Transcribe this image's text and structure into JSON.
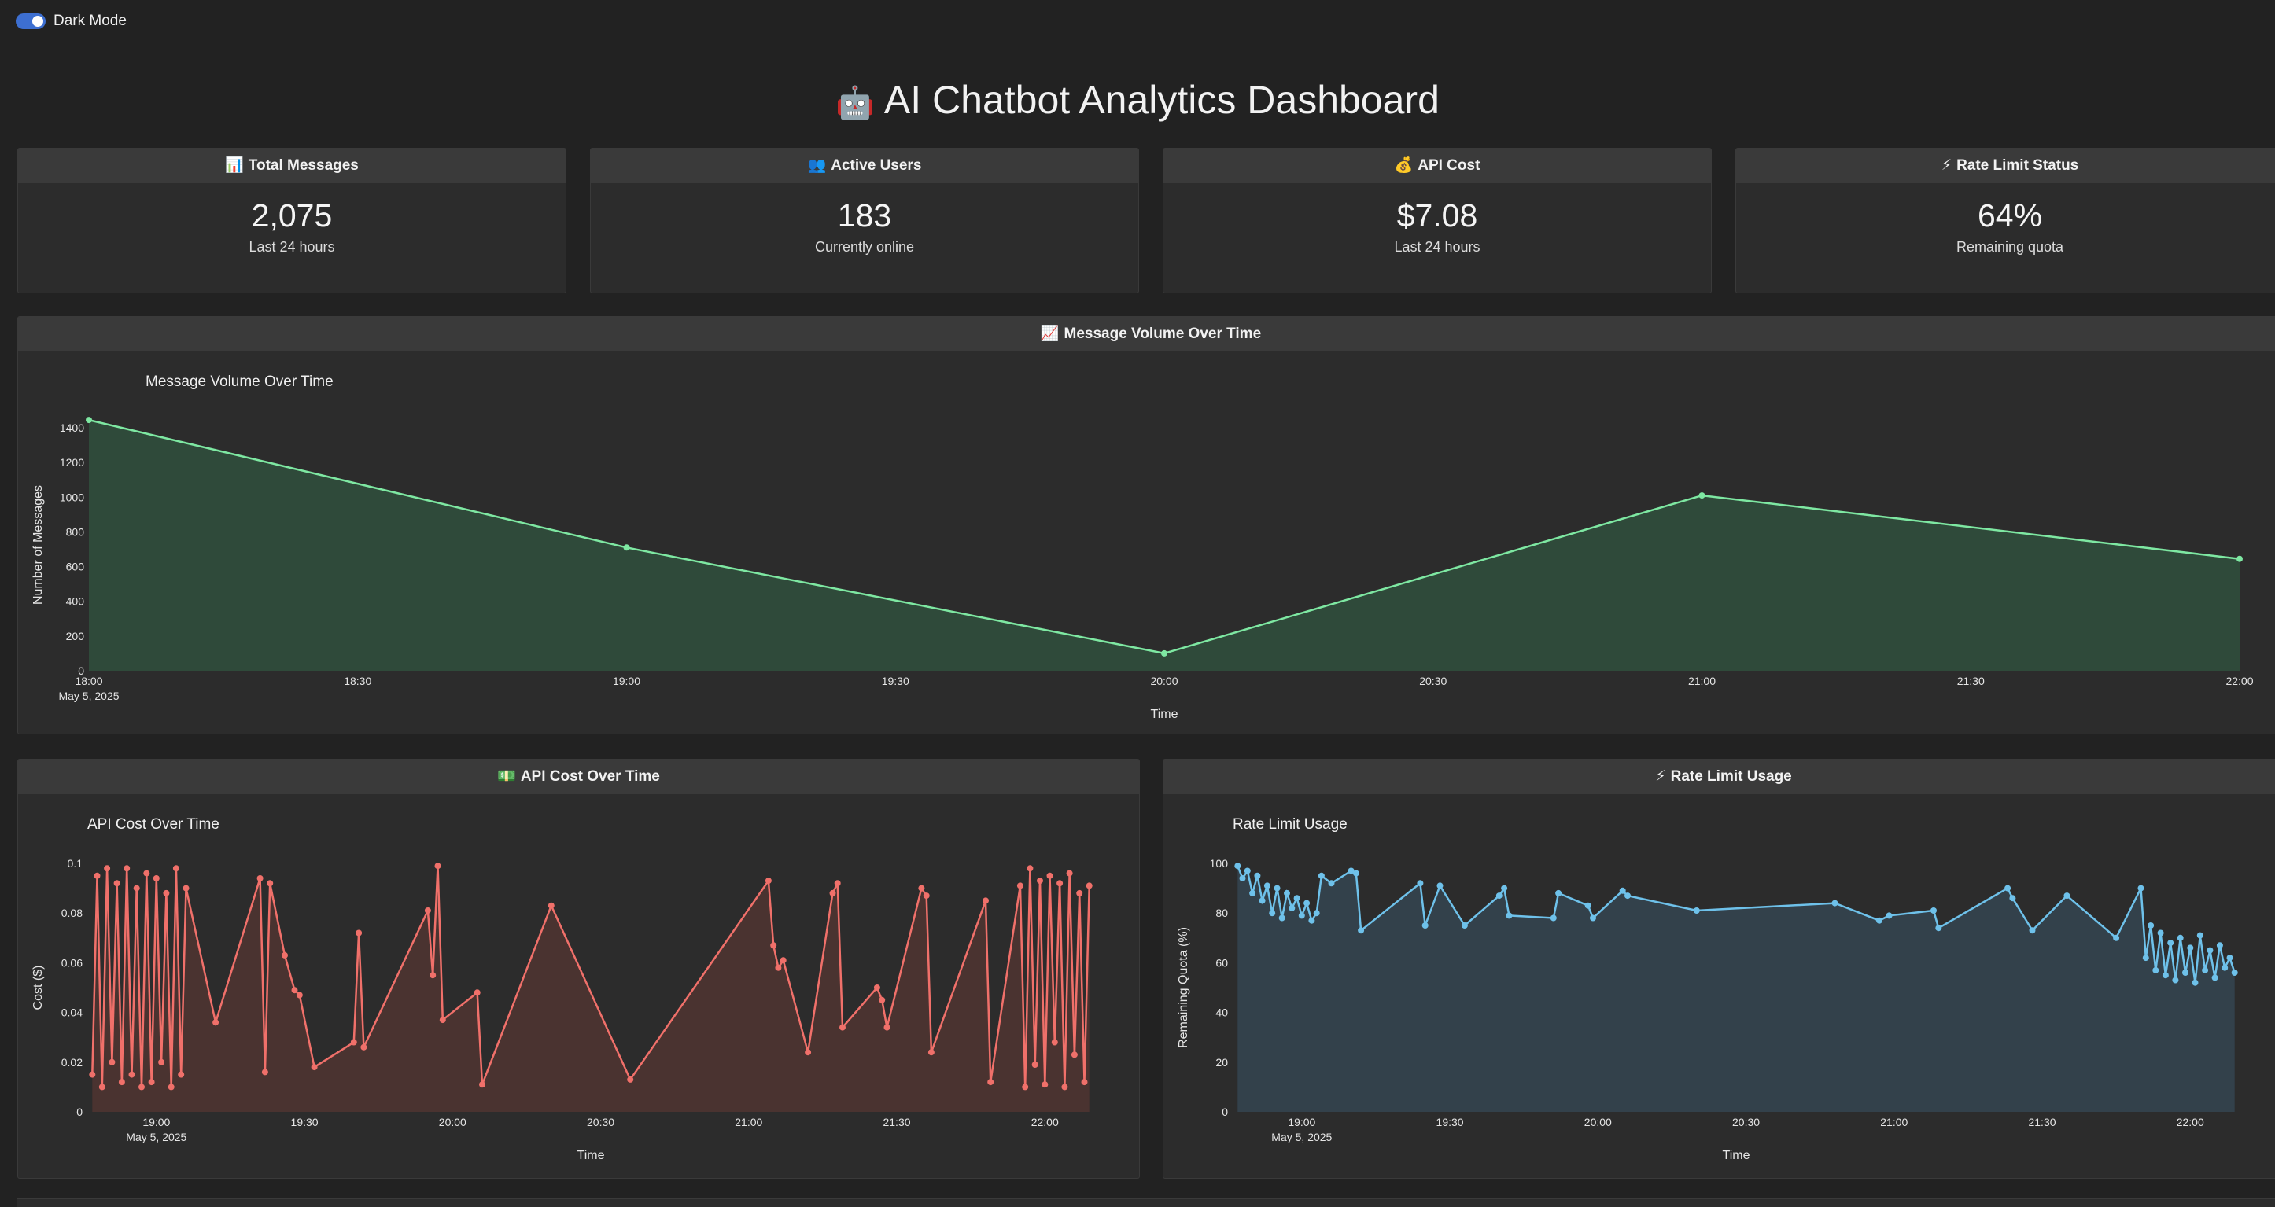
{
  "toggle": {
    "label": "Dark Mode",
    "on": true
  },
  "title": {
    "emoji": "🤖",
    "text": "AI Chatbot Analytics Dashboard"
  },
  "metrics": [
    {
      "icon": "📊",
      "label": "Total Messages",
      "value": "2,075",
      "sub": "Last 24 hours"
    },
    {
      "icon": "👥",
      "label": "Active Users",
      "value": "183",
      "sub": "Currently online"
    },
    {
      "icon": "💰",
      "label": "API Cost",
      "value": "$7.08",
      "sub": "Last 24 hours"
    },
    {
      "icon": "⚡",
      "label": "Rate Limit Status",
      "value": "64%",
      "sub": "Remaining quota"
    }
  ],
  "panels": {
    "volume": {
      "icon": "📈",
      "label": "Message Volume Over Time"
    },
    "cost": {
      "icon": "💵",
      "label": "API Cost Over Time"
    },
    "rate": {
      "icon": "⚡",
      "label": "Rate Limit Usage"
    }
  },
  "chart_data": [
    {
      "id": "volume",
      "type": "area",
      "title": "Message Volume Over Time",
      "xlabel": "Time",
      "ylabel": "Number of Messages",
      "color": "#7ee8a2",
      "fill": "#2f4a3a",
      "xlim": [
        "18:00",
        "22:00"
      ],
      "ylim": [
        0,
        1450
      ],
      "x_ticks": [
        "18:00",
        "18:30",
        "19:00",
        "19:30",
        "20:00",
        "20:30",
        "21:00",
        "21:30",
        "22:00"
      ],
      "x_date_label": "May 5, 2025",
      "y_ticks": [
        0,
        200,
        400,
        600,
        800,
        1000,
        1200,
        1400
      ],
      "x": [
        "18:00",
        "19:00",
        "20:00",
        "21:00",
        "22:00"
      ],
      "y": [
        1445,
        710,
        100,
        1010,
        645
      ]
    },
    {
      "id": "cost",
      "type": "area",
      "title": "API Cost Over Time",
      "xlabel": "Time",
      "ylabel": "Cost ($)",
      "color": "#f0706a",
      "fill": "#4a3330",
      "xlim": [
        "18:46",
        "22:10"
      ],
      "ylim": [
        0,
        0.1
      ],
      "x_ticks": [
        "19:00",
        "19:30",
        "20:00",
        "20:30",
        "21:00",
        "21:30",
        "22:00"
      ],
      "x_date_label": "May 5, 2025",
      "y_ticks": [
        0,
        0.02,
        0.04,
        0.06,
        0.08,
        0.1
      ],
      "x": [
        "18:47",
        "18:48",
        "18:49",
        "18:50",
        "18:51",
        "18:52",
        "18:53",
        "18:54",
        "18:55",
        "18:56",
        "18:57",
        "18:58",
        "18:59",
        "19:00",
        "19:01",
        "19:02",
        "19:03",
        "19:04",
        "19:05",
        "19:06",
        "19:12",
        "19:21",
        "19:22",
        "19:23",
        "19:26",
        "19:28",
        "19:29",
        "19:32",
        "19:40",
        "19:41",
        "19:42",
        "19:55",
        "19:56",
        "19:57",
        "19:58",
        "20:05",
        "20:06",
        "20:20",
        "20:36",
        "21:04",
        "21:05",
        "21:06",
        "21:07",
        "21:12",
        "21:17",
        "21:18",
        "21:19",
        "21:26",
        "21:27",
        "21:28",
        "21:35",
        "21:36",
        "21:37",
        "21:48",
        "21:49",
        "21:55",
        "21:56",
        "21:57",
        "21:58",
        "21:59",
        "22:00",
        "22:01",
        "22:02",
        "22:03",
        "22:04",
        "22:05",
        "22:06",
        "22:07",
        "22:08",
        "22:09"
      ],
      "y": [
        0.015,
        0.095,
        0.01,
        0.098,
        0.02,
        0.092,
        0.012,
        0.098,
        0.015,
        0.09,
        0.01,
        0.096,
        0.012,
        0.094,
        0.02,
        0.088,
        0.01,
        0.098,
        0.015,
        0.09,
        0.036,
        0.094,
        0.016,
        0.092,
        0.063,
        0.049,
        0.047,
        0.018,
        0.028,
        0.072,
        0.026,
        0.081,
        0.055,
        0.099,
        0.037,
        0.048,
        0.011,
        0.083,
        0.013,
        0.093,
        0.067,
        0.058,
        0.061,
        0.024,
        0.088,
        0.092,
        0.034,
        0.05,
        0.045,
        0.034,
        0.09,
        0.087,
        0.024,
        0.085,
        0.012,
        0.091,
        0.01,
        0.098,
        0.019,
        0.093,
        0.011,
        0.095,
        0.028,
        0.092,
        0.01,
        0.096,
        0.023,
        0.088,
        0.012,
        0.091
      ]
    },
    {
      "id": "rate",
      "type": "area",
      "title": "Rate Limit Usage",
      "xlabel": "Time",
      "ylabel": "Remaining Quota (%)",
      "color": "#6ec1ea",
      "fill": "#33414b",
      "xlim": [
        "18:46",
        "22:10"
      ],
      "ylim": [
        0,
        100
      ],
      "x_ticks": [
        "19:00",
        "19:30",
        "20:00",
        "20:30",
        "21:00",
        "21:30",
        "22:00"
      ],
      "x_date_label": "May 5, 2025",
      "y_ticks": [
        0,
        20,
        40,
        60,
        80,
        100
      ],
      "x": [
        "18:47",
        "18:48",
        "18:49",
        "18:50",
        "18:51",
        "18:52",
        "18:53",
        "18:54",
        "18:55",
        "18:56",
        "18:57",
        "18:58",
        "18:59",
        "19:00",
        "19:01",
        "19:02",
        "19:03",
        "19:04",
        "19:06",
        "19:10",
        "19:11",
        "19:12",
        "19:24",
        "19:25",
        "19:28",
        "19:33",
        "19:40",
        "19:41",
        "19:42",
        "19:51",
        "19:52",
        "19:58",
        "19:59",
        "20:05",
        "20:06",
        "20:20",
        "20:48",
        "20:57",
        "20:59",
        "21:08",
        "21:09",
        "21:23",
        "21:24",
        "21:28",
        "21:35",
        "21:45",
        "21:50",
        "21:51",
        "21:52",
        "21:53",
        "21:54",
        "21:55",
        "21:56",
        "21:57",
        "21:58",
        "21:59",
        "22:00",
        "22:01",
        "22:02",
        "22:03",
        "22:04",
        "22:05",
        "22:06",
        "22:07",
        "22:08",
        "22:09"
      ],
      "y": [
        99,
        94,
        97,
        88,
        95,
        85,
        91,
        80,
        90,
        78,
        88,
        82,
        86,
        79,
        84,
        77,
        80,
        95,
        92,
        97,
        96,
        73,
        92,
        75,
        91,
        75,
        87,
        90,
        79,
        78,
        88,
        83,
        78,
        89,
        87,
        81,
        84,
        77,
        79,
        81,
        74,
        90,
        86,
        73,
        87,
        70,
        90,
        62,
        75,
        57,
        72,
        55,
        68,
        53,
        70,
        56,
        66,
        52,
        71,
        57,
        65,
        54,
        67,
        58,
        62,
        56
      ]
    }
  ]
}
